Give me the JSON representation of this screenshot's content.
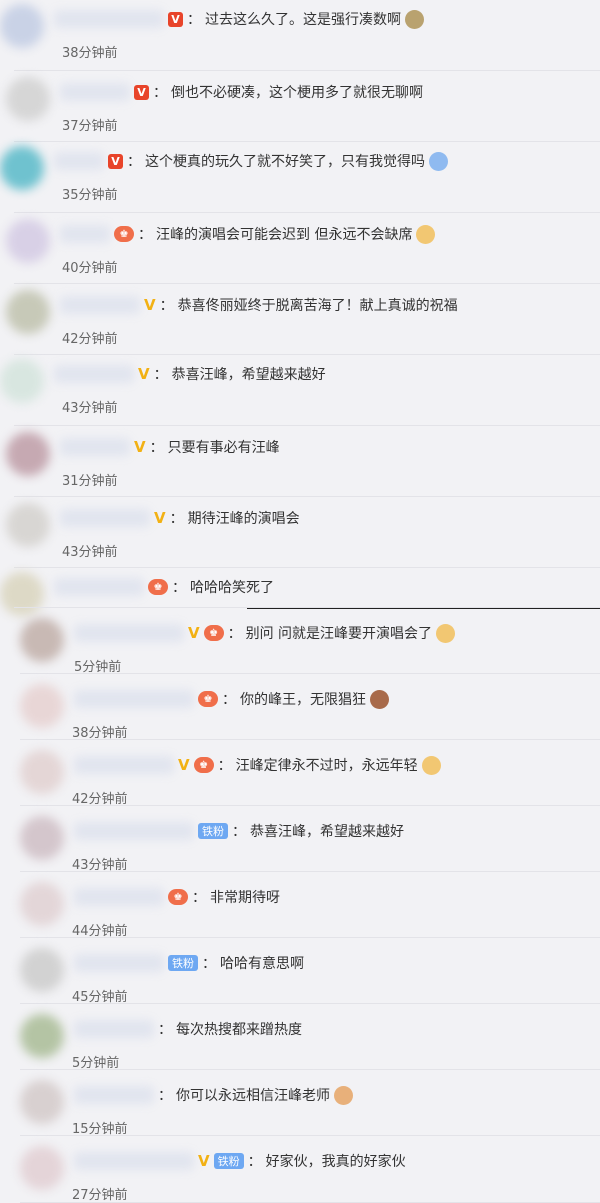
{
  "comments": [
    {
      "text": "过去这么久了。这是强行凑数啊",
      "time": "38分钟前",
      "badge": "v-red",
      "emoji": "fig",
      "emoji_name": "figure-emoji"
    },
    {
      "text": "倒也不必硬凑，这个梗用多了就很无聊啊",
      "time": "37分钟前",
      "badge": "v-red",
      "emoji": "",
      "emoji_name": ""
    },
    {
      "text": "这个梗真的玩久了就不好笑了，只有我觉得吗",
      "time": "35分钟前",
      "badge": "v-red",
      "emoji": "blue",
      "emoji_name": "shrug-emoji"
    },
    {
      "text": "汪峰的演唱会可能会迟到 但永远不会缺席",
      "time": "40分钟前",
      "badge": "crown",
      "emoji": "dog",
      "emoji_name": "dog-emoji"
    },
    {
      "text": "恭喜佟丽娅终于脱离苦海了！献上真诚的祝福",
      "time": "42分钟前",
      "badge": "v-gold",
      "emoji": "",
      "emoji_name": ""
    },
    {
      "text": "恭喜汪峰，希望越来越好",
      "time": "43分钟前",
      "badge": "v-gold",
      "emoji": "",
      "emoji_name": ""
    },
    {
      "text": "只要有事必有汪峰",
      "time": "31分钟前",
      "badge": "v-gold",
      "emoji": "",
      "emoji_name": ""
    },
    {
      "text": "期待汪峰的演唱会",
      "time": "43分钟前",
      "badge": "v-gold",
      "emoji": "",
      "emoji_name": ""
    },
    {
      "text": "哈哈哈笑死了",
      "time": "",
      "badge": "crown",
      "emoji": "",
      "emoji_name": ""
    },
    {
      "text": "别问 问就是汪峰要开演唱会了",
      "time": "5分钟前",
      "badge": "v-gold+lv",
      "emoji": "dog",
      "emoji_name": "dog-emoji"
    },
    {
      "text": "你的峰王，无限猖狂",
      "time": "38分钟前",
      "badge": "lv",
      "emoji": "monkey",
      "emoji_name": "monkey-emoji"
    },
    {
      "text": "汪峰定律永不过时，永远年轻",
      "time": "42分钟前",
      "badge": "v-gold+lv",
      "emoji": "dog",
      "emoji_name": "dog-emoji"
    },
    {
      "text": "恭喜汪峰，希望越来越好",
      "time": "43分钟前",
      "badge": "fan",
      "emoji": "",
      "emoji_name": ""
    },
    {
      "text": "非常期待呀",
      "time": "44分钟前",
      "badge": "lv",
      "emoji": "",
      "emoji_name": ""
    },
    {
      "text": "哈哈有意思啊",
      "time": "45分钟前",
      "badge": "fan",
      "emoji": "",
      "emoji_name": ""
    },
    {
      "text": "每次热搜都来蹭热度",
      "time": "5分钟前",
      "badge": "none",
      "emoji": "",
      "emoji_name": ""
    },
    {
      "text": "你可以永远相信汪峰老师",
      "time": "15分钟前",
      "badge": "none",
      "emoji": "cat",
      "emoji_name": "cat-emoji"
    },
    {
      "text": "好家伙，我真的好家伙",
      "time": "27分钟前",
      "badge": "v-gold+fan",
      "emoji": "",
      "emoji_name": ""
    }
  ],
  "labels": {
    "colon": "：",
    "fan_badge": "铁粉",
    "v_mark": "V",
    "lv_mark": "♚"
  }
}
